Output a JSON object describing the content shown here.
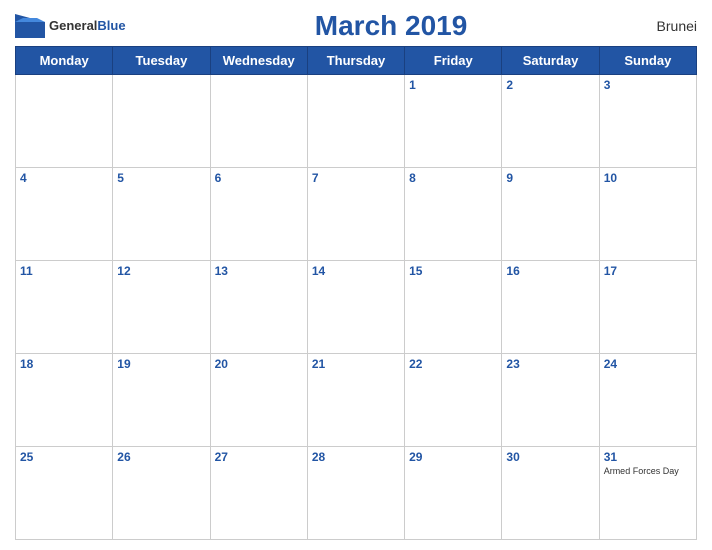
{
  "header": {
    "logo_general": "General",
    "logo_blue": "Blue",
    "title": "March 2019",
    "country": "Brunei"
  },
  "weekdays": [
    "Monday",
    "Tuesday",
    "Wednesday",
    "Thursday",
    "Friday",
    "Saturday",
    "Sunday"
  ],
  "weeks": [
    [
      {
        "day": null
      },
      {
        "day": null
      },
      {
        "day": null
      },
      {
        "day": null
      },
      {
        "day": "1"
      },
      {
        "day": "2"
      },
      {
        "day": "3"
      }
    ],
    [
      {
        "day": "4"
      },
      {
        "day": "5"
      },
      {
        "day": "6"
      },
      {
        "day": "7"
      },
      {
        "day": "8"
      },
      {
        "day": "9"
      },
      {
        "day": "10"
      }
    ],
    [
      {
        "day": "11"
      },
      {
        "day": "12"
      },
      {
        "day": "13"
      },
      {
        "day": "14"
      },
      {
        "day": "15"
      },
      {
        "day": "16"
      },
      {
        "day": "17"
      }
    ],
    [
      {
        "day": "18"
      },
      {
        "day": "19"
      },
      {
        "day": "20"
      },
      {
        "day": "21"
      },
      {
        "day": "22"
      },
      {
        "day": "23"
      },
      {
        "day": "24"
      }
    ],
    [
      {
        "day": "25"
      },
      {
        "day": "26"
      },
      {
        "day": "27"
      },
      {
        "day": "28"
      },
      {
        "day": "29"
      },
      {
        "day": "30"
      },
      {
        "day": "31",
        "event": "Armed Forces Day"
      }
    ]
  ]
}
